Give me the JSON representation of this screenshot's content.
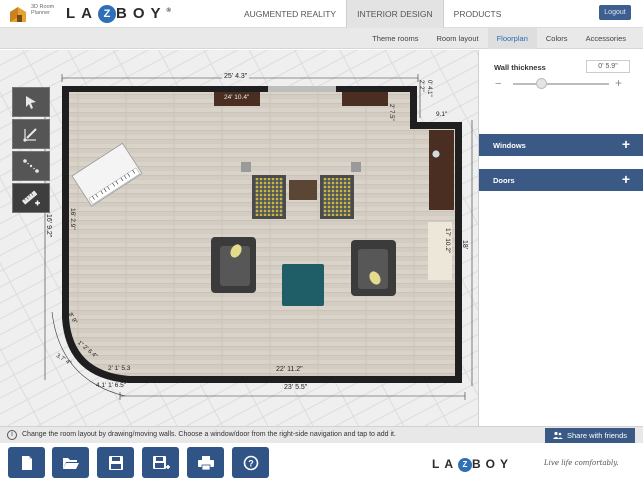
{
  "app": {
    "logo_text": "3D Room Planner",
    "brand_pre": "LA",
    "brand_mid": "Z",
    "brand_post": "BOY",
    "registered": "®",
    "logout_label": "Logout"
  },
  "top_tabs": [
    {
      "label": "AUGMENTED REALITY",
      "active": false
    },
    {
      "label": "INTERIOR DESIGN",
      "active": true
    },
    {
      "label": "PRODUCTS",
      "active": false
    }
  ],
  "sub_tabs": [
    {
      "label": "Theme rooms",
      "active": false
    },
    {
      "label": "Room layout",
      "active": false
    },
    {
      "label": "Floorplan",
      "active": true
    },
    {
      "label": "Colors",
      "active": false
    },
    {
      "label": "Accessories",
      "active": false
    }
  ],
  "tools": [
    {
      "name": "select-tool",
      "icon": "arrow-pointer-icon"
    },
    {
      "name": "draw-wall-tool",
      "icon": "pencil-line-icon"
    },
    {
      "name": "edit-points-tool",
      "icon": "dotted-line-icon"
    },
    {
      "name": "measure-tool",
      "icon": "ruler-add-icon"
    }
  ],
  "dimensions": {
    "top": "25' 4.3\"",
    "top_inner": "24' 10.4\"",
    "top_right_vert": "2' 7.5\"",
    "top_right_a": "0' 4.1\"",
    "top_right_b": "2' 2\"",
    "right_notch": "9.1\"",
    "right_outer": "18' 9\"",
    "right_inner": "17' 10.2\"",
    "left_outer": "16' 9.2\"",
    "left_inner": "16' 2.9\"",
    "bottom_outer": "23' 5.5\"",
    "bottom_inner": "22' 11.2\"",
    "bottom_corner": "2' 1' 5.3",
    "corner_a": "4.1' 1' 6.5\"",
    "corner_b": "3.7' 4\"",
    "corner_c": "8' 9\"",
    "corner_d": "1\" 2' 6.4\""
  },
  "right_panel": {
    "wall_thickness_label": "Wall thickness",
    "wall_thickness_value": "0' 5.9\"",
    "slider_percent": 30,
    "sections": [
      {
        "label": "Windows",
        "icon": "plus-icon"
      },
      {
        "label": "Doors",
        "icon": "plus-icon"
      }
    ]
  },
  "status": {
    "icon": "info-icon",
    "text": "Change the room layout by drawing/moving walls. Choose a window/door from the right-side navigation and tap to add it.",
    "share_label": "Share with friends"
  },
  "bottom_buttons": [
    {
      "name": "new-file-button",
      "icon": "file-icon"
    },
    {
      "name": "open-folder-button",
      "icon": "folder-open-icon"
    },
    {
      "name": "save-button",
      "icon": "floppy-disk-icon"
    },
    {
      "name": "save-as-button",
      "icon": "floppy-plus-icon"
    },
    {
      "name": "print-button",
      "icon": "printer-icon"
    },
    {
      "name": "help-button",
      "icon": "question-icon"
    }
  ],
  "footer": {
    "tagline": "Live life comfortably."
  },
  "colors": {
    "accent_blue": "#3a5a85",
    "button_blue": "#2f5485",
    "active_tab_text": "#2a6cb3",
    "wall": "#1f1f1f",
    "ottoman": "#1f5e66"
  }
}
